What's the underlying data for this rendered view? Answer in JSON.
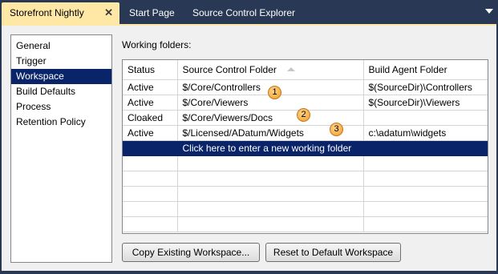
{
  "tabs": [
    {
      "label": "Storefront Nightly",
      "active": true,
      "close_glyph": "✕"
    },
    {
      "label": "Start Page",
      "active": false
    },
    {
      "label": "Source Control Explorer",
      "active": false
    }
  ],
  "nav": {
    "items": [
      {
        "label": "General"
      },
      {
        "label": "Trigger"
      },
      {
        "label": "Workspace",
        "selected": true
      },
      {
        "label": "Build Defaults"
      },
      {
        "label": "Process"
      },
      {
        "label": "Retention Policy"
      }
    ]
  },
  "workspace": {
    "section_label": "Working folders:",
    "columns": [
      "Status",
      "Source Control Folder",
      "Build Agent Folder"
    ],
    "sorted_column": "Source Control Folder",
    "rows": [
      {
        "status": "Active",
        "folder": "$/Core/Controllers",
        "agent": "$(SourceDir)\\Controllers"
      },
      {
        "status": "Active",
        "folder": "$/Core/Viewers",
        "agent": "$(SourceDir)\\Viewers"
      },
      {
        "status": "Cloaked",
        "folder": "$/Core/Viewers/Docs",
        "agent": ""
      },
      {
        "status": "Active",
        "folder": "$/Licensed/ADatum/Widgets",
        "agent": "c:\\adatum\\widgets"
      }
    ],
    "new_row_text": "Click here to enter a new working folder",
    "callouts": [
      "1",
      "2",
      "3"
    ]
  },
  "buttons": {
    "copy": "Copy Existing Workspace...",
    "reset": "Reset to Default Workspace"
  },
  "colors": {
    "frame": "#293955",
    "active_tab": "#ffe8a6",
    "selection": "#0a246a",
    "callout": "#f29b2c"
  }
}
